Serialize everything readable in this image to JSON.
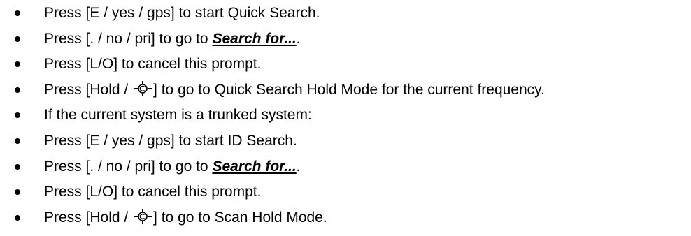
{
  "items": [
    {
      "pre": "Press [E / yes / gps] to start Quick Search."
    },
    {
      "pre": "Press [. / no / pri] to go to ",
      "link": "Search for...",
      "post": "."
    },
    {
      "pre": "Press [L/O] to cancel this prompt."
    },
    {
      "pre": "Press [Hold / ",
      "icon": "scan-hold-icon",
      "post": "] to go to Quick Search Hold Mode for the current frequency."
    },
    {
      "pre": "If the current system is a trunked system:"
    },
    {
      "pre": "Press [E / yes / gps] to start ID Search."
    },
    {
      "pre": "Press [. / no / pri] to go to ",
      "link": "Search for...",
      "post": "."
    },
    {
      "pre": "Press [L/O] to cancel this prompt."
    },
    {
      "pre": "Press [Hold / ",
      "icon": "scan-hold-icon",
      "post": "] to go to Scan Hold Mode."
    }
  ]
}
